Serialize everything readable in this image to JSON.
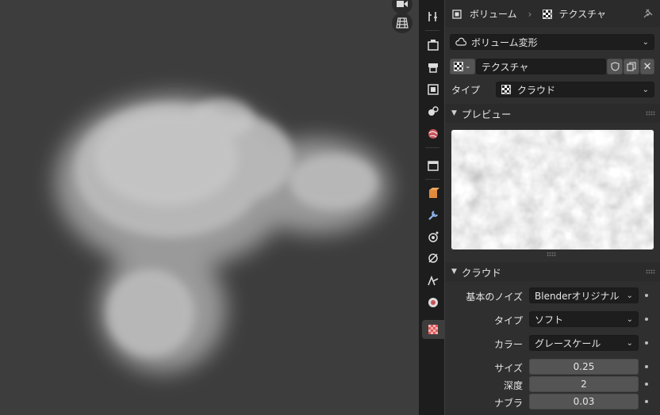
{
  "header": {
    "breadcrumb_object": "ボリューム",
    "breadcrumb_sep": "›",
    "breadcrumb_texture": "テクスチャ"
  },
  "modifier_select": {
    "value": "ボリューム変形"
  },
  "texture_block": {
    "name": "テクスチャ"
  },
  "type_row": {
    "label": "タイプ",
    "value": "クラウド"
  },
  "preview_section": {
    "title": "プレビュー"
  },
  "cloud_section": {
    "title": "クラウド",
    "noise_basis": {
      "label": "基本のノイズ",
      "value": "Blenderオリジナル"
    },
    "type": {
      "label": "タイプ",
      "value": "ソフト"
    },
    "color": {
      "label": "カラー",
      "value": "グレースケール"
    },
    "size": {
      "label": "サイズ",
      "value": "0.25"
    },
    "depth": {
      "label": "深度",
      "value": "2"
    },
    "nabla": {
      "label": "ナブラ",
      "value": "0.03"
    }
  },
  "tab_icons": [
    "tool-icon",
    "render-icon",
    "output-icon",
    "view-layer-icon",
    "scene-icon",
    "world-icon",
    "collection-icon",
    "object-icon",
    "modifier-icon",
    "particles-icon",
    "physics-icon",
    "constraints-icon",
    "data-icon",
    "material-icon",
    "texture-icon"
  ],
  "colors": {
    "accent": "#e05a5a",
    "panel": "#2f2f2f",
    "field_dark": "#1d1d1d",
    "field_light": "#545454"
  }
}
